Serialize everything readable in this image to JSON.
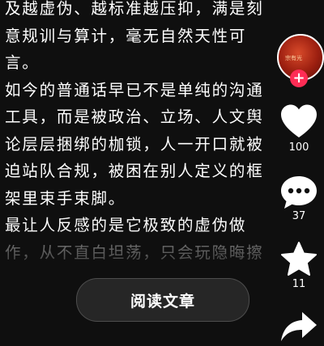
{
  "article": {
    "lines": [
      "及越虚伪、越标准越压抑，满是刻",
      "意规训与算计，毫无自然天性可",
      "言。",
      "如今的普通话早已不是单纯的沟通",
      "工具，而是被政治、立场、人文舆",
      "论层层捆绑的枷锁，人一开口就被",
      "迫站队合规，被困在别人定义的框",
      "架里束手束脚。",
      "最让人反感的是它极致的虚伪做",
      "作，从不直白坦荡，只会玩隐晦擦"
    ]
  },
  "read_button": {
    "label": "阅读文章"
  },
  "sidebar": {
    "avatar": {
      "text": "宗有光"
    },
    "follow_symbol": "+",
    "like": {
      "icon": "heart-icon",
      "count": "100"
    },
    "comment": {
      "icon": "comment-icon",
      "count": "37"
    },
    "favorite": {
      "icon": "star-icon",
      "count": "11"
    },
    "share": {
      "icon": "share-icon"
    }
  },
  "colors": {
    "background": "#0f0f0f",
    "accent": "#fe2c55",
    "icon": "#ffffff"
  }
}
